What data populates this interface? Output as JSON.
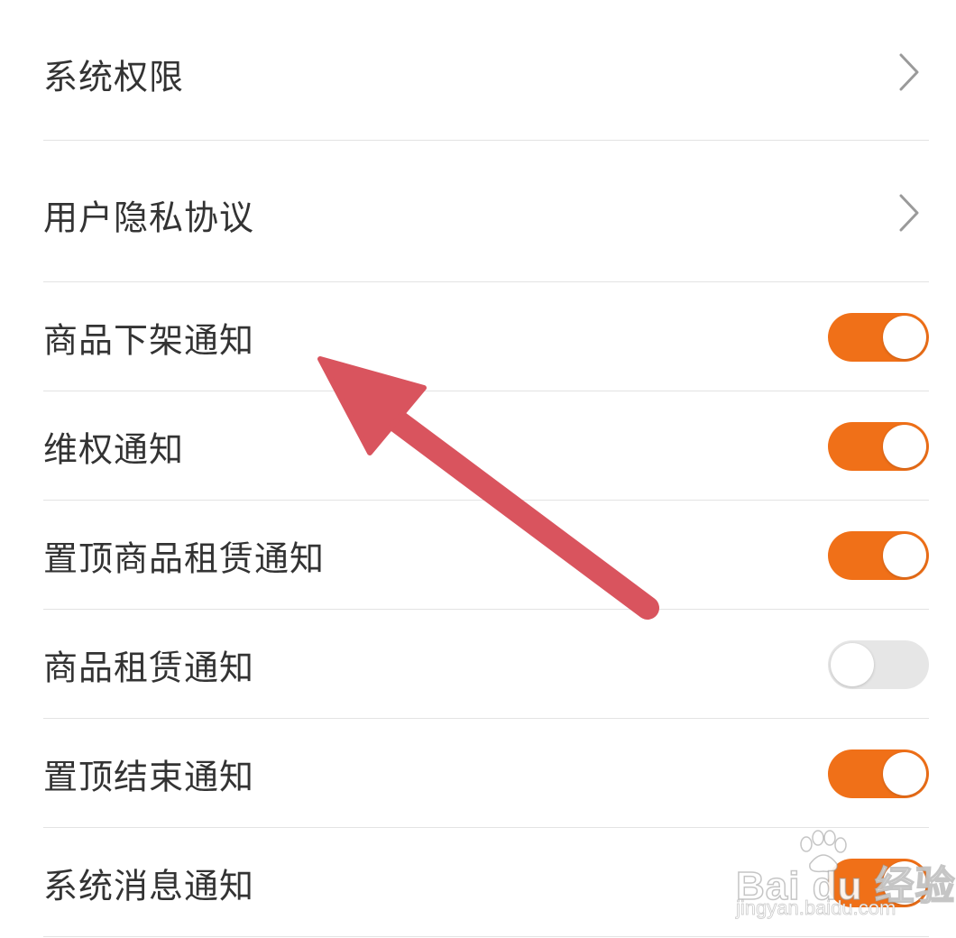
{
  "settings": {
    "items": [
      {
        "label": "系统权限",
        "type": "link"
      },
      {
        "label": "用户隐私协议",
        "type": "link"
      },
      {
        "label": "商品下架通知",
        "type": "toggle",
        "on": true
      },
      {
        "label": "维权通知",
        "type": "toggle",
        "on": true
      },
      {
        "label": "置顶商品租赁通知",
        "type": "toggle",
        "on": true
      },
      {
        "label": "商品租赁通知",
        "type": "toggle",
        "on": false
      },
      {
        "label": "置顶结束通知",
        "type": "toggle",
        "on": true
      },
      {
        "label": "系统消息通知",
        "type": "toggle",
        "on": true
      }
    ]
  },
  "icons": {
    "chevron": "chevron-right-icon",
    "annotation": "red-arrow-annotation"
  },
  "colors": {
    "toggle_on": "#f07018",
    "toggle_off": "#e6e6e6",
    "label_text": "#333333",
    "arrow": "#d9545e"
  },
  "watermark": {
    "brand": "Bai du 经验",
    "url": "jingyan.baidu.com"
  }
}
